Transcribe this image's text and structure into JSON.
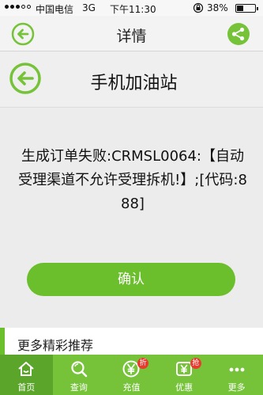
{
  "status_bar": {
    "carrier": "中国电信",
    "network": "3G",
    "time": "下午11:30",
    "battery_percent": "38%",
    "battery_level": 0.38
  },
  "title_bar": {
    "title": "详情",
    "back_icon": "back-arrow-icon",
    "share_icon": "share-icon"
  },
  "header": {
    "title": "手机加油站",
    "back_icon": "back-arrow-icon"
  },
  "message": {
    "text": "生成订单失败:CRMSL0064:【自动受理渠道不允许受理拆机!】;[代码:888]"
  },
  "confirm_button": {
    "label": "确认"
  },
  "more_section": {
    "title": "更多精彩推荐"
  },
  "tab_bar": {
    "accent": "#76c33a",
    "active_bg": "#5aa52a",
    "items": [
      {
        "label": "首页",
        "icon": "home-icon",
        "active": true
      },
      {
        "label": "查询",
        "icon": "search-icon",
        "active": false
      },
      {
        "label": "充值",
        "icon": "yen-coin-icon",
        "active": false,
        "badge": "折"
      },
      {
        "label": "优惠",
        "icon": "yen-tag-icon",
        "active": false,
        "badge": "抢"
      },
      {
        "label": "更多",
        "icon": "more-dots-icon",
        "active": false
      }
    ]
  }
}
